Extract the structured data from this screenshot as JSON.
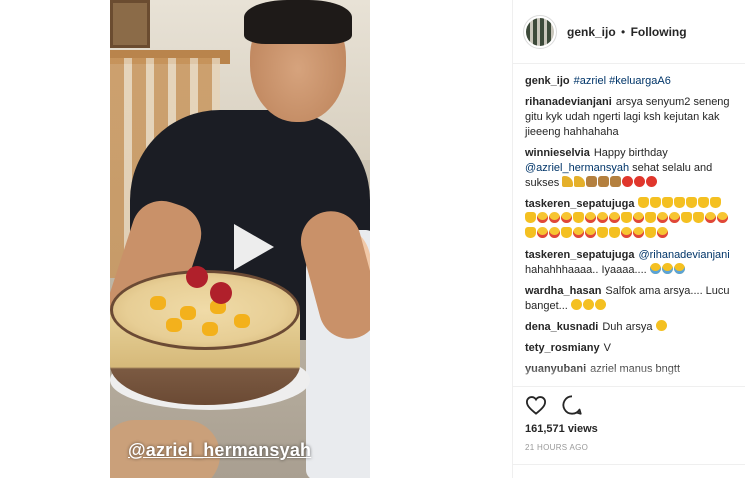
{
  "header": {
    "username": "genk_ijo",
    "separator": "•",
    "follow_status": "Following"
  },
  "video": {
    "watermark": "@azriel_hermansyah",
    "play_icon": "play-icon"
  },
  "caption": {
    "user": "genk_ijo",
    "text": "#azriel #keluargaA6"
  },
  "comments": [
    {
      "user": "rihanadevianjani",
      "text": "arsya senyum2 seneng gitu kyk udah ngerti lagi ksh kejutan kak jieeeng hahhahaha",
      "emojis": []
    },
    {
      "user": "winnieselvia",
      "text": "Happy birthday",
      "mention": "@azriel_hermansyah",
      "text2": "sehat selalu and sukses",
      "emojis": [
        "hat",
        "hat",
        "cake",
        "cake",
        "cake",
        "balloon",
        "balloon",
        "balloon"
      ]
    },
    {
      "user": "taskeren_sepatujuga",
      "text": "",
      "emojis": [
        "thumb",
        "thumb",
        "thumb",
        "thumb",
        "thumb",
        "thumb",
        "thumb",
        "thumb",
        "love",
        "love",
        "love",
        "thumb",
        "love",
        "love",
        "love",
        "thumb",
        "love",
        "thumb",
        "love",
        "love",
        "thumb",
        "thumb",
        "love",
        "love",
        "thumb",
        "love",
        "love",
        "thumb",
        "love",
        "love",
        "thumb",
        "thumb",
        "love",
        "love",
        "thumb",
        "love"
      ]
    },
    {
      "user": "taskeren_sepatujuga",
      "mention": "@rihanadevianjani",
      "text2": "hahahhhaaaa.. Iyaaaa....",
      "emojis": [
        "laugh",
        "laugh",
        "laugh"
      ]
    },
    {
      "user": "wardha_hasan",
      "text": "Salfok ama arsya.... Lucu banget...",
      "emojis": [
        "smile",
        "smile",
        "smile"
      ]
    },
    {
      "user": "dena_kusnadi",
      "text": "Duh arsya",
      "emojis": [
        "smile"
      ]
    },
    {
      "user": "tety_rosmiany",
      "text": "V",
      "emojis": []
    },
    {
      "user": "yuanyubani",
      "text": "azriel manus bngtt",
      "emojis": []
    }
  ],
  "actions": {
    "like_icon": "heart-icon",
    "comment_icon": "comment-icon",
    "views": "161,571 views",
    "time_ago": "21 HOURS AGO"
  }
}
